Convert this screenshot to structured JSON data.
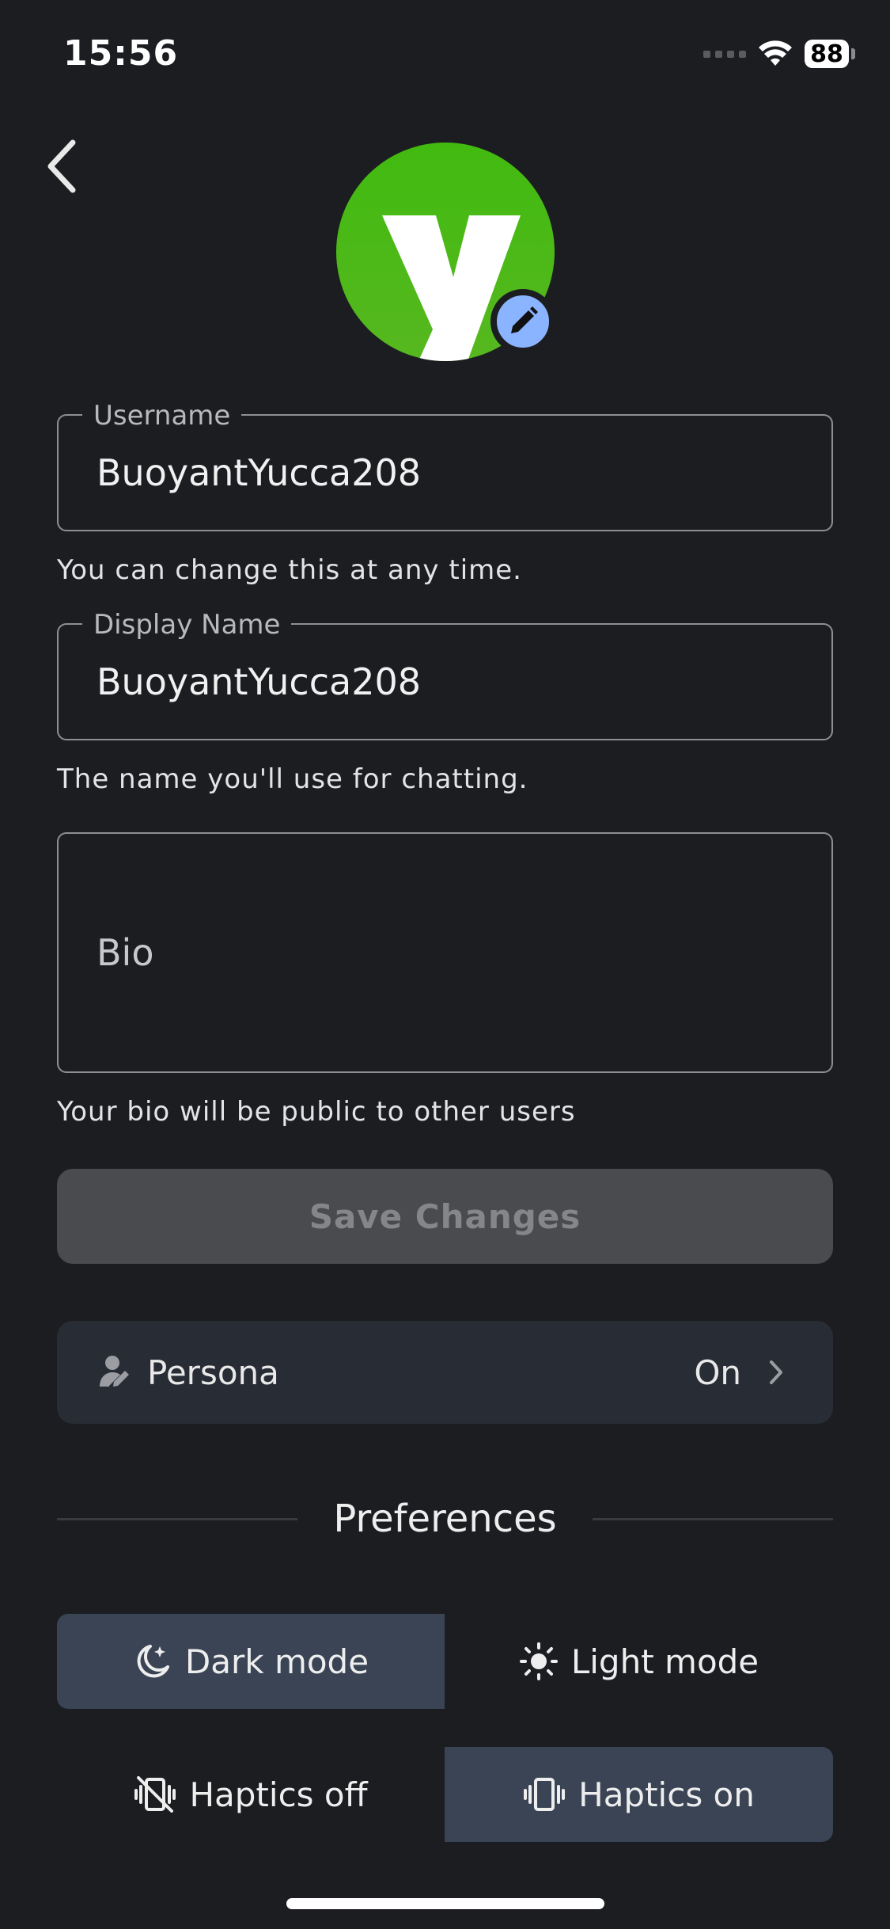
{
  "status_bar": {
    "time": "15:56",
    "battery": "88"
  },
  "profile": {
    "username_label": "Username",
    "username_value": "BuoyantYucca208",
    "username_helper": "You can change this at any time.",
    "display_name_label": "Display Name",
    "display_name_value": "BuoyantYucca208",
    "display_name_helper": "The name you'll use for chatting.",
    "bio_placeholder": "Bio",
    "bio_helper": "Your bio will be public to other users",
    "save_label": "Save Changes"
  },
  "persona": {
    "label": "Persona",
    "value": "On"
  },
  "preferences": {
    "title": "Preferences",
    "dark_mode": "Dark mode",
    "light_mode": "Light mode",
    "haptics_off": "Haptics off",
    "haptics_on": "Haptics on",
    "selected_theme": "dark",
    "selected_haptics": "on"
  },
  "colors": {
    "background": "#1c1d20",
    "avatar_green": "#41ba10",
    "edit_badge": "#8ab4ff",
    "selected_segment": "#3a4454"
  },
  "icons": {
    "back": "chevron-left-icon",
    "edit": "pencil-icon",
    "persona": "user-edit-icon",
    "dark_mode": "moon-stars-icon",
    "light_mode": "sun-icon",
    "haptics_off": "vibrate-off-icon",
    "haptics_on": "vibrate-icon"
  }
}
